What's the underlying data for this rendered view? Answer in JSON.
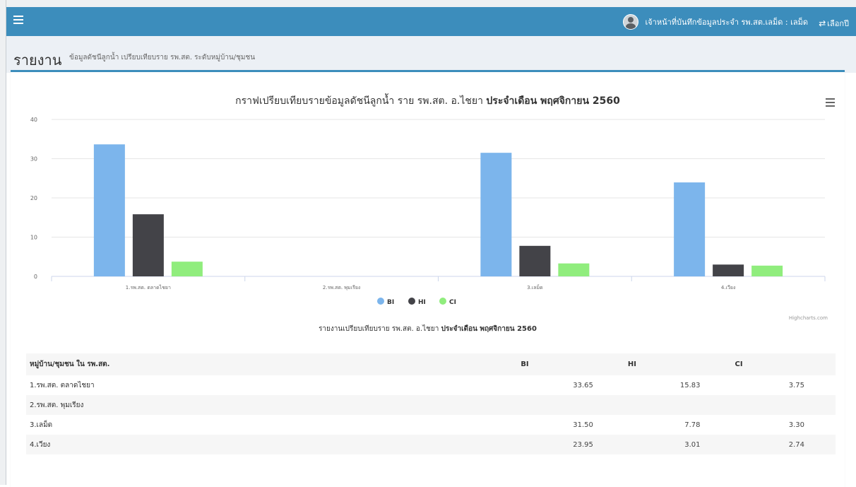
{
  "topbar": {
    "user_text": "เจ้าหน้าที่บันทึกข้อมูลประจำ รพ.สต.เลม็ด : เลม็ด",
    "switch_label": "เลือกปี",
    "color": "#3c8dbc"
  },
  "header": {
    "title": "รายงาน",
    "subtitle": "ข้อมูลดัชนีลูกน้ำ เปรียบเทียบราย รพ.สต. ระดับหมู่บ้าน/ชุมชน"
  },
  "chart_title": {
    "normal": "กราฟเปรียบเทียบรายข้อมูลดัชนีลูกน้ำ ราย รพ.สต. อ.ไชยา",
    "bold": "ประจำเดือน พฤศจิกายน 2560"
  },
  "credits": "Highcharts.com",
  "table_caption": {
    "normal": "รายงานเปรียบเทียบราย รพ.สต. อ.ไชยา",
    "bold": "ประจำเดือน พฤศจิกายน 2560"
  },
  "chart_data": {
    "type": "bar",
    "categories": [
      "1.รพ.สต. ตลาดไชยา",
      "2.รพ.สต. พุมเรียง",
      "3.เลม็ด",
      "4.เวียง"
    ],
    "series": [
      {
        "name": "BI",
        "color": "#7cb5ec",
        "values": [
          33.65,
          null,
          31.5,
          23.95
        ]
      },
      {
        "name": "HI",
        "color": "#434348",
        "values": [
          15.83,
          null,
          7.78,
          3.01
        ]
      },
      {
        "name": "CI",
        "color": "#90ed7d",
        "values": [
          3.75,
          null,
          3.3,
          2.74
        ]
      }
    ],
    "ylim": [
      0,
      40
    ],
    "yticks": [
      0,
      10,
      20,
      30,
      40
    ],
    "grid": true,
    "legend": "bottom-center"
  },
  "table": {
    "headers": [
      "หมู่บ้าน/ชุมชน ใน รพ.สต.",
      "BI",
      "HI",
      "CI"
    ],
    "rows": [
      [
        "1.รพ.สต. ตลาดไชยา",
        "33.65",
        "15.83",
        "3.75"
      ],
      [
        "2.รพ.สต. พุมเรียง",
        "",
        "",
        ""
      ],
      [
        "3.เลม็ด",
        "31.50",
        "7.78",
        "3.30"
      ],
      [
        "4.เวียง",
        "23.95",
        "3.01",
        "2.74"
      ]
    ]
  }
}
